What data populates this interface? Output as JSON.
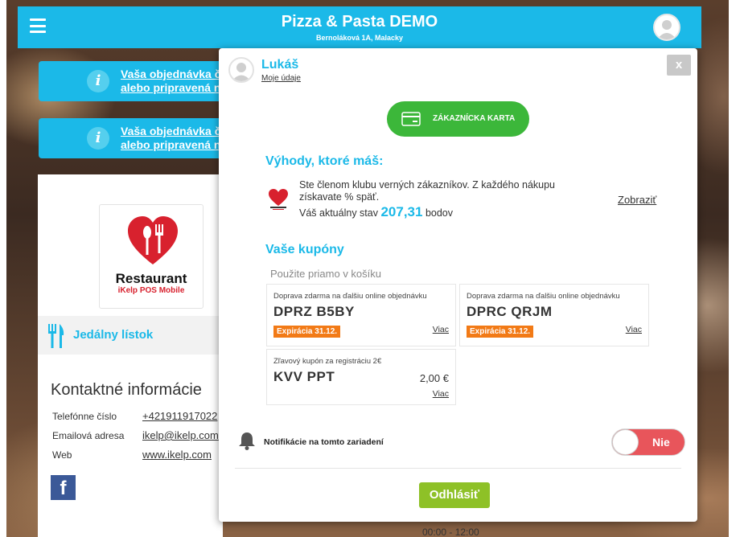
{
  "header": {
    "title": "Pizza & Pasta DEMO",
    "subtitle": "Bernoláková 1A, Malacky",
    "accent_color": "#1bb9e8"
  },
  "banners": [
    {
      "text_line1": "Vaša objednávka č",
      "text_line2": "alebo pripravená n"
    },
    {
      "text_line1": "Vaša objednávka č",
      "text_line2": "alebo pripravená n"
    }
  ],
  "left_panel": {
    "logo_title": "Restaurant",
    "logo_subtitle": "iKelp POS Mobile",
    "menu_label": "Jedálny lístok",
    "contact_title": "Kontaktné informácie",
    "contacts": [
      {
        "label": "Telefónne číslo",
        "value": "+421911917022"
      },
      {
        "label": "Emailová adresa",
        "value": "ikelp@ikelp.com"
      },
      {
        "label": "Web",
        "value": "www.ikelp.com"
      }
    ],
    "facebook_glyph": "f",
    "hours_peek": "00:00 - 12:00"
  },
  "modal": {
    "user_name": "Lukáš",
    "my_data_link": "Moje údaje",
    "close_label": "x",
    "card_button_label": "ZÁKAZNÍCKA KARTA",
    "benefits_title": "Výhody, ktoré máš:",
    "loyalty_text": "Ste členom klubu verných zákazníkov. Z každého nákupu získavate % späť.",
    "loyalty_state_prefix": "Váš aktuálny stav",
    "loyalty_points": "207,31",
    "loyalty_state_suffix": "bodov",
    "show_link": "Zobraziť",
    "coupons_title": "Vaše kupóny",
    "use_hint": "Použite priamo v košíku",
    "coupons": [
      {
        "description": "Doprava zdarma na ďalšiu online objednávku",
        "code": "DPRZ B5BY",
        "expiry": "Expirácia 31.12.",
        "more": "Viac"
      },
      {
        "description": "Doprava zdarma na ďalšiu online objednávku",
        "code": "DPRC QRJM",
        "expiry": "Expirácia 31.12.",
        "more": "Viac"
      },
      {
        "description": "Zľavový kupón za registráciu 2€",
        "code": "KVV PPT",
        "price": "2,00 €",
        "more": "Viac"
      }
    ],
    "notification_label": "Notifikácie na tomto zariadení",
    "notification_toggle": "Nie",
    "logout_label": "Odhlásiť",
    "colors": {
      "green": "#3cb73a",
      "orange": "#f27a16",
      "red": "#e8555b",
      "lime": "#8ec127"
    }
  }
}
